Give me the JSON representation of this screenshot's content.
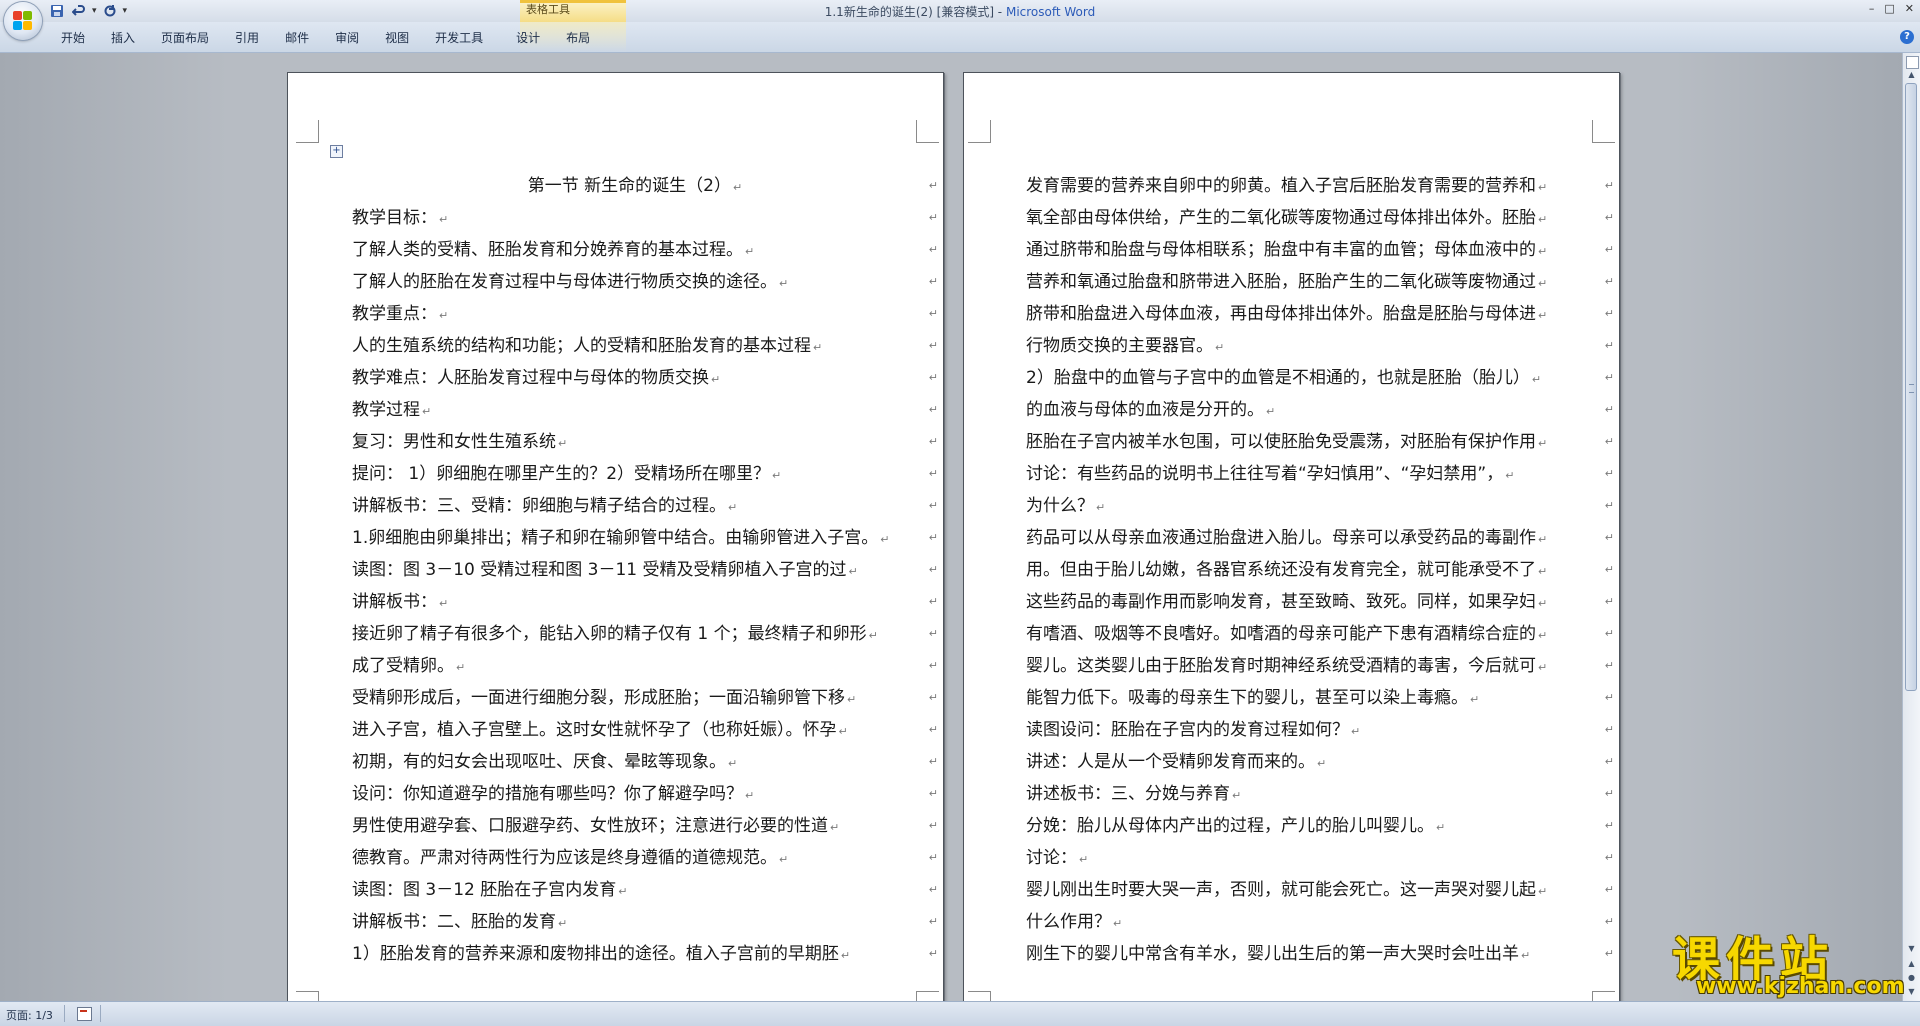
{
  "window": {
    "title": "1.1新生命的诞生(2) [兼容模式] - ",
    "app_name": "Microsoft Word",
    "controls": [
      "–",
      "□",
      "✕"
    ]
  },
  "quick_access": {
    "save_icon": "save-icon",
    "undo_icon": "undo-icon",
    "redo_icon": "redo-icon",
    "customize_icon": "dropdown-icon"
  },
  "ribbon": {
    "context_group": "表格工具",
    "tabs": [
      "开始",
      "插入",
      "页面布局",
      "引用",
      "邮件",
      "审阅",
      "视图",
      "开发工具",
      "设计",
      "布局"
    ],
    "help": "?"
  },
  "pages": {
    "left": {
      "lines": [
        "第一节 新生命的诞生（2）",
        "教学目标：",
        "了解人类的受精、胚胎发育和分娩养育的基本过程。",
        "了解人的胚胎在发育过程中与母体进行物质交换的途径。",
        "教学重点： ",
        "人的生殖系统的结构和功能；人的受精和胚胎发育的基本过程",
        "教学难点：人胚胎发育过程中与母体的物质交换",
        "教学过程",
        "复习：男性和女性生殖系统",
        "提问：  1）卵细胞在哪里产生的？2）受精场所在哪里？",
        "讲解板书：三、受精：卵细胞与精子结合的过程。",
        "1.卵细胞由卵巢排出；精子和卵在输卵管中结合。由输卵管进入子宫。",
        "读图：图 3－10  受精过程和图 3－11  受精及受精卵植入子宫的过",
        "讲解板书：",
        "接近卵了精子有很多个，能钻入卵的精子仅有 1 个；最终精子和卵形",
        "成了受精卵。",
        " 受精卵形成后，一面进行细胞分裂，形成胚胎；一面沿输卵管下移",
        "进入子宫，植入子宫壁上。这时女性就怀孕了（也称妊娠）。怀孕",
        "初期，有的妇女会出现呕吐、厌食、晕眩等现象。",
        " 设问：你知道避孕的措施有哪些吗？你了解避孕吗？",
        "男性使用避孕套、口服避孕药、女性放环；注意进行必要的性道",
        "德教育。严肃对待两性行为应该是终身遵循的道德规范。",
        "读图：图 3－12  胚胎在子宫内发育",
        "讲解板书：二、胚胎的发育",
        "  1）胚胎发育的营养来源和废物排出的途径。植入子宫前的早期胚"
      ]
    },
    "right": {
      "lines": [
        "发育需要的营养来自卵中的卵黄。植入子宫后胚胎发育需要的营养和",
        "氧全部由母体供给，产生的二氧化碳等废物通过母体排出体外。胚胎",
        "通过脐带和胎盘与母体相联系；胎盘中有丰富的血管；母体血液中的",
        "营养和氧通过胎盘和脐带进入胚胎，胚胎产生的二氧化碳等废物通过",
        "脐带和胎盘进入母体血液，再由母体排出体外。胎盘是胚胎与母体进",
        "行物质交换的主要器官。",
        "2）胎盘中的血管与子宫中的血管是不相通的，也就是胚胎（胎儿）",
        "的血液与母体的血液是分开的。",
        "胚胎在子宫内被羊水包围，可以使胚胎免受震荡，对胚胎有保护作用",
        "讨论：有些药品的说明书上往往写着“孕妇慎用”、“孕妇禁用”，",
        "为什么？",
        "药品可以从母亲血液通过胎盘进入胎儿。母亲可以承受药品的毒副作",
        "用。但由于胎儿幼嫩，各器官系统还没有发育完全，就可能承受不了",
        "这些药品的毒副作用而影响发育，甚至致畸、致死。同样，如果孕妇",
        "有嗜酒、吸烟等不良嗜好。如嗜酒的母亲可能产下患有酒精综合症的",
        "婴儿。这类婴儿由于胚胎发育时期神经系统受酒精的毒害，今后就可",
        "能智力低下。吸毒的母亲生下的婴儿，甚至可以染上毒瘾。",
        "读图设问：胚胎在子宫内的发育过程如何？",
        "  讲述：人是从一个受精卵发育而来的。",
        "讲述板书：三、分娩与养育",
        "分娩：胎儿从母体内产出的过程，产儿的胎儿叫婴儿。",
        "讨论：",
        "婴儿刚出生时要大哭一声，否则，就可能会死亡。这一声哭对婴儿起",
        "什么作用？",
        "刚生下的婴儿中常含有羊水，婴儿出生后的第一声大哭时会吐出羊"
      ]
    }
  },
  "marks": {
    "paragraph": "↵",
    "cell_end": "↵",
    "table_move": "+"
  },
  "statusbar": {
    "page_info": "页面: 1/3"
  },
  "watermark": {
    "title": "课件站",
    "url": "www.kjzhan.com"
  },
  "colors": {
    "ribbon_bg": "#dfe7f2",
    "context_tab": "#f5dd86",
    "app_name_blue": "#2c5bb8",
    "watermark_yellow": "#f7d800"
  }
}
